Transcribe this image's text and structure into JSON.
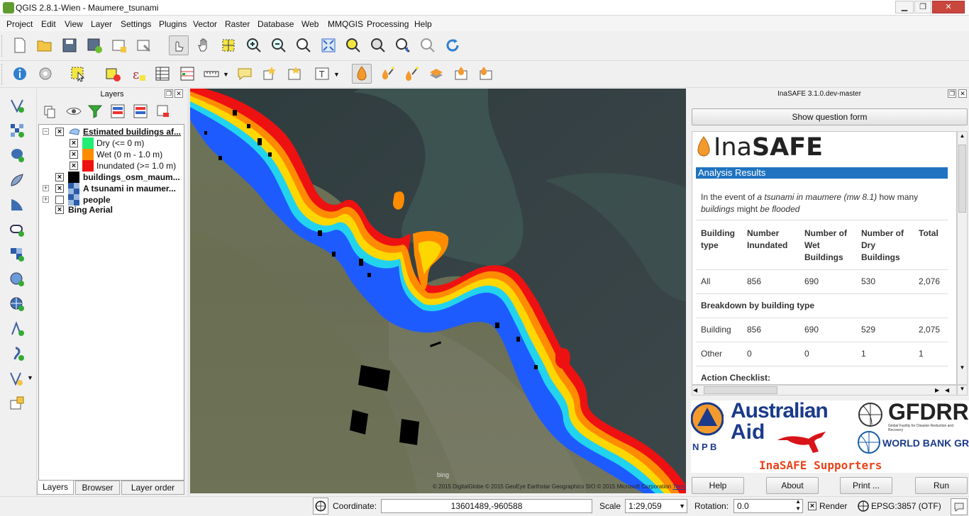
{
  "window": {
    "title": "QGIS 2.8.1-Wien - Maumere_tsunami",
    "controls": {
      "minimize": "▁",
      "maximize": "❐",
      "close": "✕"
    }
  },
  "menu": [
    "Project",
    "Edit",
    "View",
    "Layer",
    "Settings",
    "Plugins",
    "Vector",
    "Raster",
    "Database",
    "Web",
    "MMQGIS",
    "Processing",
    "Help"
  ],
  "layers_panel": {
    "title": "Layers",
    "tree": [
      {
        "label": "Estimated buildings af...",
        "checked": true,
        "expanded": true
      },
      {
        "label": "Dry (<= 0 m)",
        "checked": true,
        "color": "#22ee77"
      },
      {
        "label": "Wet (0 m - 1.0 m)",
        "checked": true,
        "color": "#ff8c00"
      },
      {
        "label": "Inundated (>= 1.0 m)",
        "checked": true,
        "color": "#ee1111"
      },
      {
        "label": "buildings_osm_maum...",
        "checked": true
      },
      {
        "label": "A tsunami in maumer...",
        "checked": true
      },
      {
        "label": "people",
        "checked": false
      },
      {
        "label": "Bing Aerial",
        "checked": true
      }
    ],
    "tabs": [
      "Layers",
      "Browser",
      "Layer order"
    ]
  },
  "map": {
    "copyright": "© 2015 DigitalGlobe © 2015 GeoEye Earthstar Geographics SIO © 2015 Microsoft Corporation",
    "terms": "Terms of Use",
    "bing": "bing"
  },
  "inasafe": {
    "title": "InaSAFE 3.1.0.dev-master",
    "show_question_form": "Show question form",
    "logo_light": "Ina",
    "logo_bold": "SAFE",
    "heading": "Analysis Results",
    "question_prefix": "In the event of ",
    "question_hazard": "a tsunami in maumere (mw 8.1)",
    "question_mid": " how many",
    "question_exposure": "buildings",
    "question_might": " might ",
    "question_impact": "be flooded",
    "table_headers": [
      "Building type",
      "Number Inundated",
      "Number of Wet Buildings",
      "Number of Dry Buildings",
      "Total"
    ],
    "row_all": [
      "All",
      "856",
      "690",
      "530",
      "2,076"
    ],
    "breakdown": "Breakdown by building type",
    "row_building": [
      "Building",
      "856",
      "690",
      "529",
      "2,075"
    ],
    "row_other": [
      "Other",
      "0",
      "0",
      "1",
      "1"
    ],
    "action_checklist": "Action Checklist:",
    "supporters": {
      "npb": "N P B",
      "australian": "Australian",
      "aid": "Aid",
      "gfdrr": "GFDRR",
      "gfdrr_sub": "Global Facility for Disaster Reduction and Recovery",
      "world_bank": "WORLD BANK GROUP",
      "caption": "InaSAFE Supporters"
    },
    "buttons": [
      "Help",
      "About",
      "Print ...",
      "Run"
    ]
  },
  "status": {
    "coordinate_label": "Coordinate:",
    "coordinate": "13601489,-960588",
    "scale_label": "Scale",
    "scale": "1:29,059",
    "rotation_label": "Rotation:",
    "rotation": "0.0",
    "render_label": "Render",
    "render_checked": true,
    "crs": "EPSG:3857 (OTF)"
  }
}
